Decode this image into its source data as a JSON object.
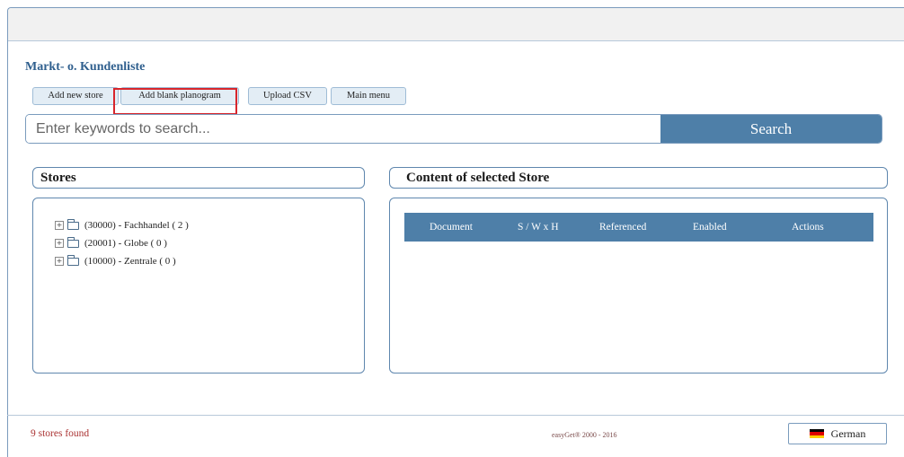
{
  "page": {
    "title": "Markt- o. Kundenliste"
  },
  "toolbar": {
    "buttons": [
      {
        "label": "Add new store"
      },
      {
        "label": "Add blank planogram"
      },
      {
        "label": "Upload CSV"
      },
      {
        "label": "Main menu"
      }
    ],
    "highlighted": "Add blank planogram"
  },
  "search": {
    "placeholder": "Enter keywords to search...",
    "button_label": "Search"
  },
  "stores_panel": {
    "header": "Stores",
    "tree": [
      {
        "label": "(30000) - Fachhandel ( 2 )",
        "expander": "+",
        "icon": "folder-icon"
      },
      {
        "label": "(20001) - Globe ( 0 )",
        "expander": "+",
        "icon": "folder-icon"
      },
      {
        "label": "(10000) - Zentrale ( 0 )",
        "expander": "+",
        "icon": "folder-icon"
      }
    ]
  },
  "content_panel": {
    "header": "Content of selected Store",
    "columns": [
      "Document",
      "S / W x H",
      "Referenced",
      "Enabled",
      "Actions"
    ]
  },
  "footer": {
    "status": "9 stores found",
    "copyright": "easyGet® 2000 - 2016",
    "language": "German"
  },
  "colors": {
    "accent": "#4e7fa8",
    "title": "#2f5f8e",
    "highlight": "#d8252b",
    "status": "#aa3333"
  }
}
